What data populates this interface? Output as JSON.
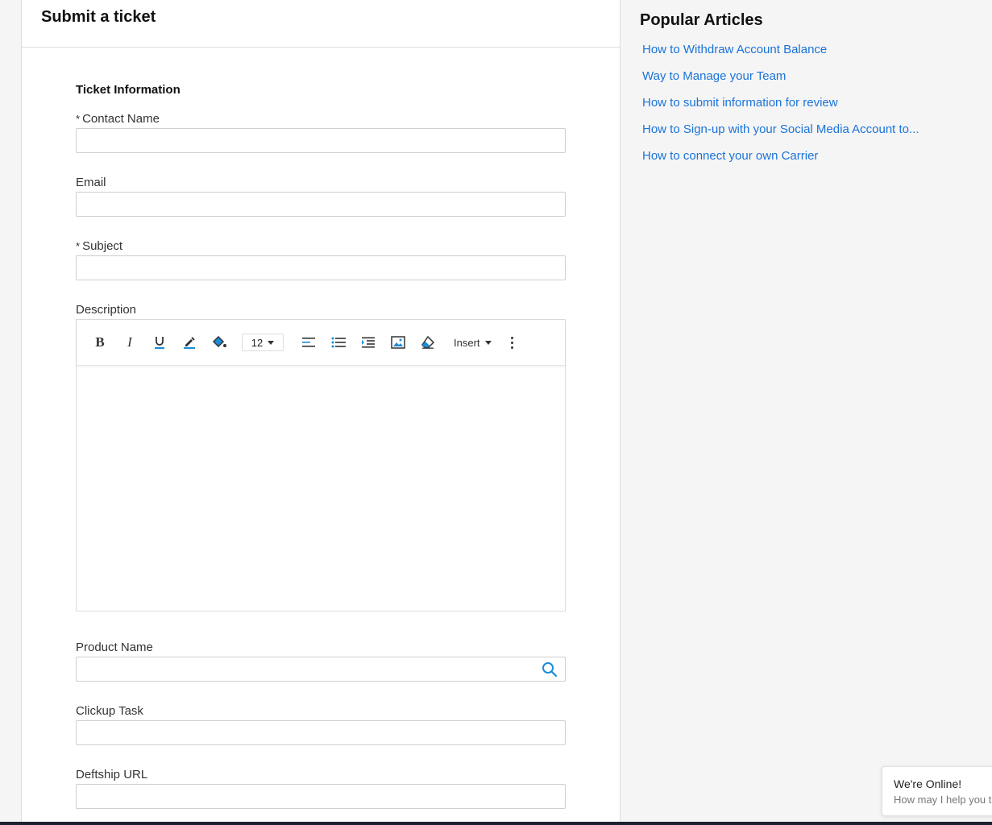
{
  "card": {
    "title": "Submit a ticket"
  },
  "form": {
    "section_title": "Ticket Information",
    "required_marker": "*",
    "contact_name": {
      "label": "Contact Name",
      "value": ""
    },
    "email": {
      "label": "Email",
      "value": ""
    },
    "subject": {
      "label": "Subject",
      "value": ""
    },
    "description": {
      "label": "Description",
      "font_size": "12",
      "insert_label": "Insert",
      "toolbar_icons": [
        "bold-icon",
        "italic-icon",
        "underline-icon",
        "text-color-icon",
        "background-color-icon",
        "font-size-select",
        "align-left-icon",
        "bulleted-list-icon",
        "indent-icon",
        "insert-image-icon",
        "clear-format-icon",
        "insert-menu",
        "more-options-icon"
      ]
    },
    "product_name": {
      "label": "Product Name",
      "value": ""
    },
    "clickup_task": {
      "label": "Clickup Task",
      "value": ""
    },
    "deftship_url": {
      "label": "Deftship URL",
      "value": ""
    }
  },
  "sidebar": {
    "title": "Popular Articles",
    "articles": [
      "How to Withdraw Account Balance",
      "Way to Manage your Team",
      "How to submit information for review",
      "How to Sign-up with your Social Media Account to...",
      "How to connect your own Carrier"
    ]
  },
  "chat": {
    "title": "We're Online!",
    "subtitle": "How may I help you today?"
  },
  "colors": {
    "link": "#1a73d9",
    "accent_icon": "#1a8cd8",
    "page_bg": "#f5f5f5",
    "bottom_bar": "#1d2030"
  }
}
